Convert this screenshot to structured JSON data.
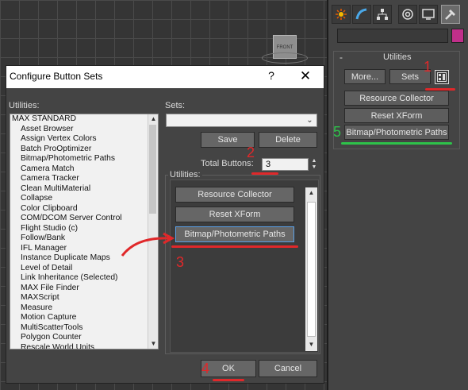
{
  "viewport": {
    "viewcube_label": "FRONT"
  },
  "command_panel": {
    "tabs": [
      "create-icon",
      "modify-icon",
      "hierarchy-icon",
      "motion-icon",
      "display-icon",
      "utilities-icon"
    ],
    "rollout_title": "Utilities",
    "rollout_toggle": "-",
    "more_label": "More...",
    "sets_label": "Sets",
    "buttons": [
      "Resource Collector",
      "Reset XForm",
      "Bitmap/Photometric Paths"
    ],
    "swatch_color": "#c12f8a"
  },
  "dialog": {
    "title": "Configure Button Sets",
    "help": "?",
    "close": "✕",
    "utilities_label": "Utilities:",
    "utilities_items": [
      "MAX STANDARD",
      "Asset Browser",
      "Assign Vertex Colors",
      "Batch ProOptimizer",
      "Bitmap/Photometric Paths",
      "Camera Match",
      "Camera Tracker",
      "Clean MultiMaterial",
      "Collapse",
      "Color Clipboard",
      "COM/DCOM Server Control",
      "Flight Studio (c)",
      "Follow/Bank",
      "IFL Manager",
      "Instance Duplicate Maps",
      "Level of Detail",
      "Link Inheritance (Selected)",
      "MAX File Finder",
      "MAXScript",
      "Measure",
      "Motion Capture",
      "MultiScatterTools",
      "Polygon Counter",
      "Rescale World Units"
    ],
    "sets_label": "Sets:",
    "save_label": "Save",
    "delete_label": "Delete",
    "total_buttons_label": "Total Buttons:",
    "total_buttons_value": "3",
    "group_label": "Utilities:",
    "group_buttons": [
      "Resource Collector",
      "Reset XForm",
      "Bitmap/Photometric Paths"
    ],
    "ok_label": "OK",
    "cancel_label": "Cancel"
  },
  "annotations": [
    "1",
    "2",
    "3",
    "4",
    "5"
  ],
  "annotation_color": "#e0282a",
  "annotation_green": "#2ec24a"
}
